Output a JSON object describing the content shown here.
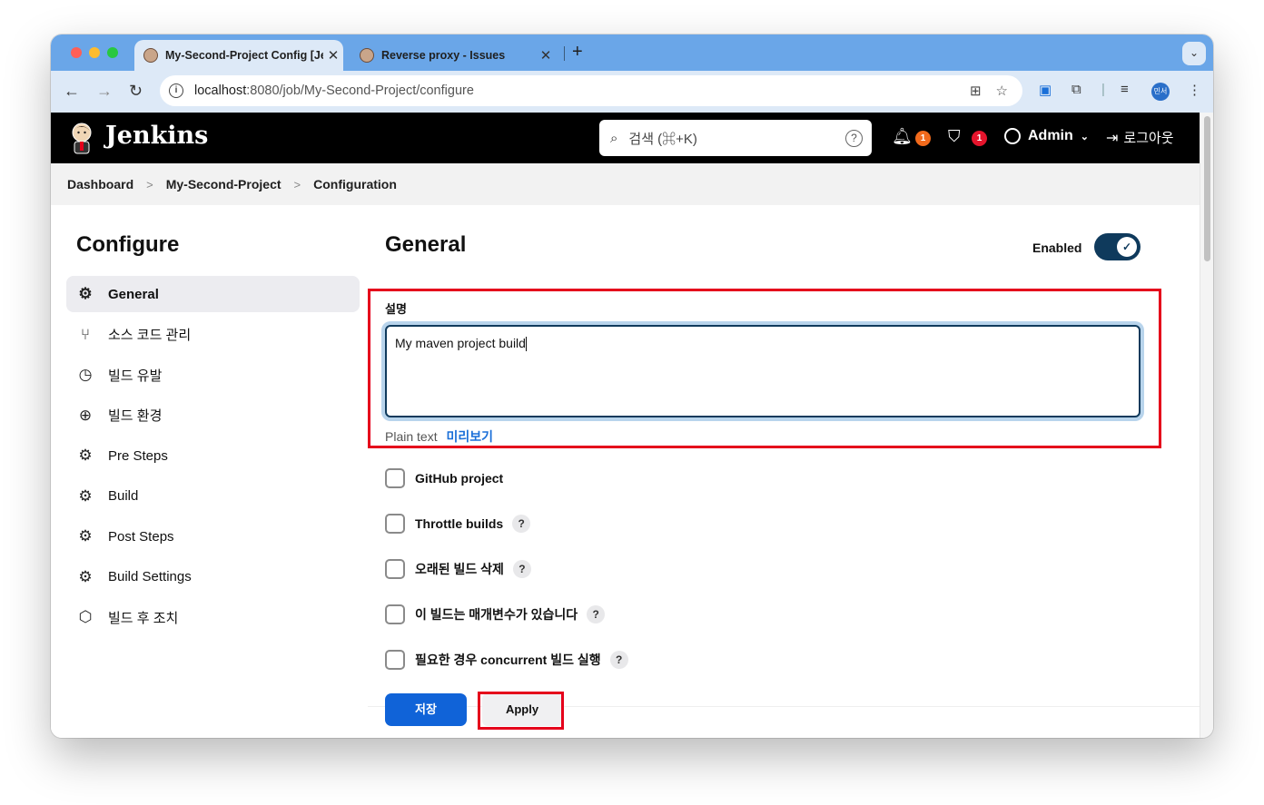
{
  "browser": {
    "tabs": [
      {
        "title": "My-Second-Project Config [Jenkins]",
        "close": "✕"
      },
      {
        "title": "Reverse proxy - Issues",
        "close": "✕"
      }
    ],
    "new_tab": "+",
    "tab_menu": "⌄",
    "url_host": "localhost",
    "url_rest": ":8080/job/My-Second-Project/configure",
    "profile_initials": "민서"
  },
  "jenkins": {
    "app_title": "Jenkins",
    "search_placeholder": "검색 (⌘+K)",
    "search_help": "?",
    "notifications_count": "1",
    "security_count": "1",
    "user": "Admin",
    "logout": "로그아웃"
  },
  "breadcrumb": [
    "Dashboard",
    "My-Second-Project",
    "Configuration"
  ],
  "sidebar": {
    "title": "Configure",
    "items": [
      {
        "label": "General",
        "icon": "gear-icon",
        "active": true
      },
      {
        "label": "소스 코드 관리",
        "icon": "branch-icon",
        "active": false
      },
      {
        "label": "빌드 유발",
        "icon": "timer-icon",
        "active": false
      },
      {
        "label": "빌드 환경",
        "icon": "globe-icon",
        "active": false
      },
      {
        "label": "Pre Steps",
        "icon": "gear-icon",
        "active": false
      },
      {
        "label": "Build",
        "icon": "gear-icon",
        "active": false
      },
      {
        "label": "Post Steps",
        "icon": "gear-icon",
        "active": false
      },
      {
        "label": "Build Settings",
        "icon": "gear-icon",
        "active": false
      },
      {
        "label": "빌드 후 조치",
        "icon": "package-icon",
        "active": false
      }
    ]
  },
  "general": {
    "title": "General",
    "enabled_label": "Enabled",
    "enabled": true,
    "description_label": "설명",
    "description_value": "My maven project build",
    "plain_text": "Plain text",
    "preview_link": "미리보기",
    "options": [
      {
        "label": "GitHub project",
        "help": false,
        "checked": false
      },
      {
        "label": "Throttle builds",
        "help": true,
        "checked": false
      },
      {
        "label": "오래된 빌드 삭제",
        "help": true,
        "checked": false
      },
      {
        "label": "이 빌드는 매개변수가 있습니다",
        "help": true,
        "checked": false
      },
      {
        "label": "필요한 경우 concurrent 빌드 실행",
        "help": true,
        "checked": false
      }
    ],
    "help_glyph": "?"
  },
  "actions": {
    "save": "저장",
    "apply": "Apply"
  },
  "colors": {
    "header_bg": "#000000",
    "accent_blue": "#1063d8",
    "toggle_bg": "#0f3a5c",
    "highlight_red": "#e5001b",
    "badge_orange": "#f26a1c",
    "badge_red": "#e5142c"
  }
}
